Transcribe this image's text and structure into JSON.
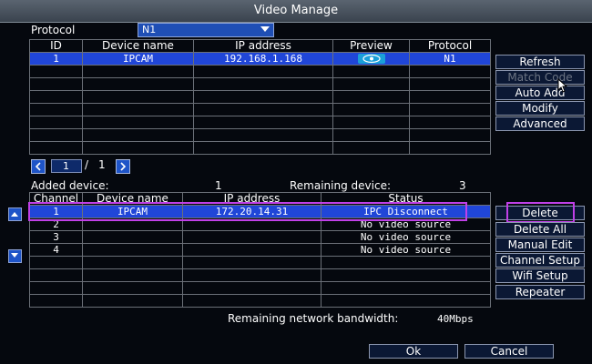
{
  "window": {
    "title": "Video Manage"
  },
  "protocol": {
    "label": "Protocol",
    "value": "N1"
  },
  "search_table": {
    "headers": [
      "ID",
      "Device name",
      "IP address",
      "Preview",
      "Protocol"
    ],
    "rows": [
      {
        "id": "1",
        "device_name": "IPCAM",
        "ip": "192.168.1.168",
        "preview": "eye-icon",
        "protocol": "N1"
      }
    ],
    "empty_rows": 7
  },
  "side_buttons": {
    "refresh": "Refresh",
    "match_code": "Match Code",
    "auto_add": "Auto Add",
    "modify": "Modify",
    "advanced": "Advanced"
  },
  "pagination": {
    "current": "1",
    "separator": "/",
    "total": "1"
  },
  "summary": {
    "added_label": "Added device:",
    "added_value": "1",
    "remaining_label": "Remaining device:",
    "remaining_value": "3"
  },
  "channel_table": {
    "headers": [
      "Channel",
      "Device name",
      "IP address",
      "Status"
    ],
    "rows": [
      {
        "channel": "1",
        "device_name": "IPCAM",
        "ip": "172.20.14.31",
        "status": "IPC Disconnect"
      },
      {
        "channel": "2",
        "device_name": "",
        "ip": "",
        "status": "No video source"
      },
      {
        "channel": "3",
        "device_name": "",
        "ip": "",
        "status": "No video source"
      },
      {
        "channel": "4",
        "device_name": "",
        "ip": "",
        "status": "No video source"
      }
    ],
    "empty_rows": 4
  },
  "channel_buttons": {
    "delete": "Delete",
    "delete_all": "Delete All",
    "manual_edit": "Manual Edit",
    "channel_setup": "Channel Setup",
    "wifi_setup": "Wifi Setup",
    "repeater": "Repeater"
  },
  "bandwidth": {
    "label": "Remaining network bandwidth:",
    "value": "40Mbps"
  },
  "footer": {
    "ok": "Ok",
    "cancel": "Cancel"
  },
  "colors": {
    "selected_row": "#2046d8",
    "highlight": "#c040e8",
    "select_bg": "#1f4fb5"
  }
}
